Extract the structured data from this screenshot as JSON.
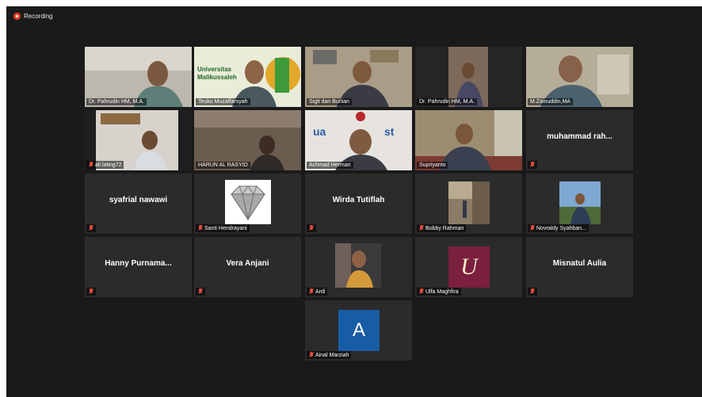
{
  "recording": {
    "icon": "record-dot-icon",
    "label": "Recording"
  },
  "participants": [
    {
      "name": "Dr. Pahrudin HM, M.A."
    },
    {
      "name": "Teuku Muzaffarsyah",
      "banner": "Universitas Malikussaleh"
    },
    {
      "name": "Sigit dan Burlian"
    },
    {
      "name": "Dr. Pahrudin HM, M.A."
    },
    {
      "name": "M.Zainuddin,MA"
    },
    {
      "name": "ali lating72",
      "muted": true
    },
    {
      "name": "HARUN AL RASYID"
    },
    {
      "name": "Achmad Herman"
    },
    {
      "name": "Supriyanto"
    },
    {
      "name": "muhammad rah...",
      "muted": true
    },
    {
      "name": "syafrial nawawi",
      "muted": true
    },
    {
      "name": "Santi Hendrayani",
      "muted": true
    },
    {
      "name": "Wirda Tutiflah",
      "muted": true
    },
    {
      "name": "Bobby Rahman",
      "muted": true
    },
    {
      "name": "Novraldy Syahban...",
      "muted": true
    },
    {
      "name": "Hanny Purnama...",
      "muted": true
    },
    {
      "name": "Vera Anjani",
      "muted": true
    },
    {
      "name": "Ardi",
      "muted": true
    },
    {
      "name": "Ulfa Maghfira",
      "muted": true,
      "initial": "U"
    },
    {
      "name": "Misnatul Aulia",
      "muted": true
    },
    {
      "name": "Ainal Marziah",
      "muted": true,
      "initial": "A"
    }
  ],
  "colors": {
    "background": "#1a1a1a",
    "tile": "#2b2b2b",
    "active_speaker": "#c9e34c",
    "mute": "#e14a3b",
    "recording": "#e8412c"
  }
}
